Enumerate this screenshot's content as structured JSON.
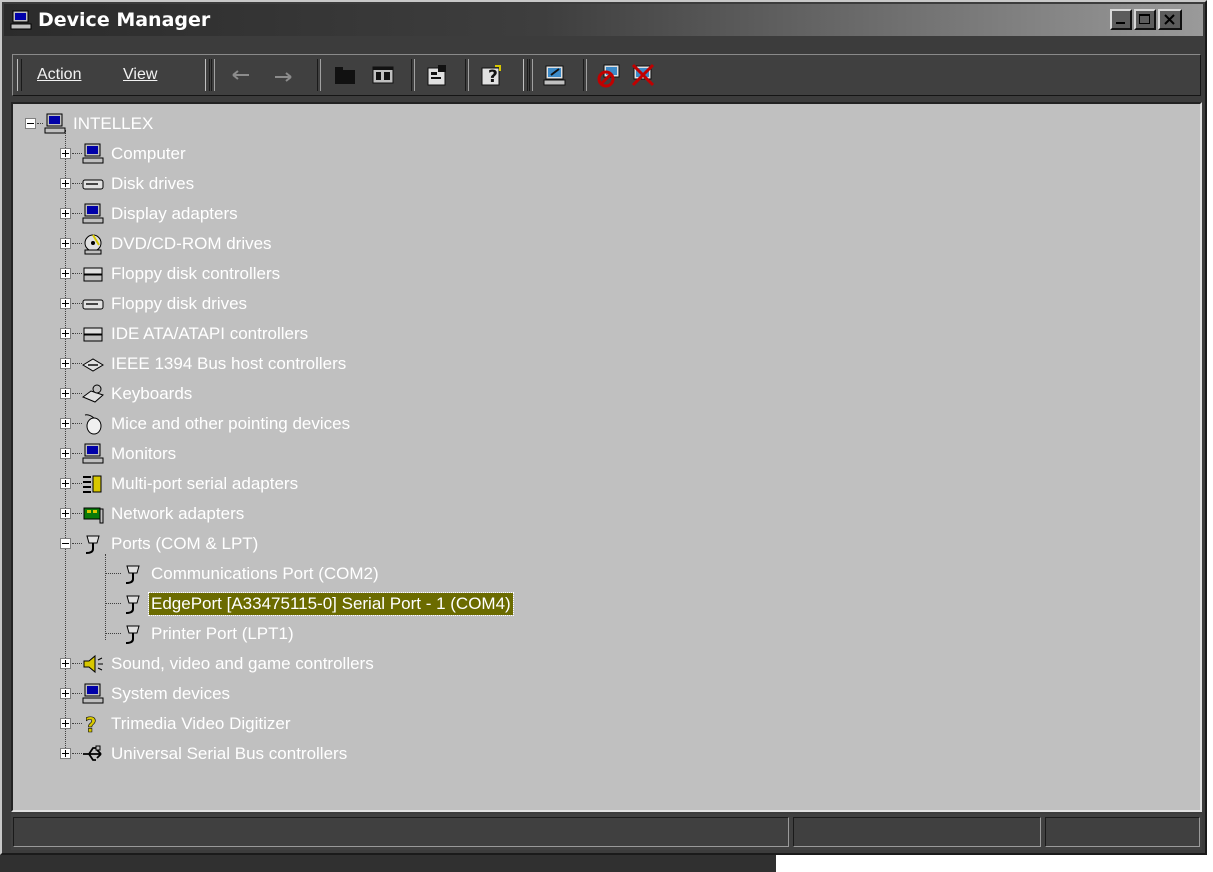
{
  "window": {
    "title": "Device Manager"
  },
  "title_buttons": {
    "minimize": "minimize-icon",
    "maximize": "maximize-icon",
    "close": "close-icon"
  },
  "menu": {
    "action": "Action",
    "view": "View"
  },
  "toolbar_icons": [
    "back-arrow-icon",
    "forward-arrow-icon",
    "up-folder-icon",
    "show-hide-tree-icon",
    "properties-icon",
    "help-icon",
    "scan-hardware-icon",
    "disable-device-icon",
    "uninstall-device-icon"
  ],
  "tree": {
    "root": "INTELLEX",
    "categories": [
      "Computer",
      "Disk drives",
      "Display adapters",
      "DVD/CD-ROM drives",
      "Floppy disk controllers",
      "Floppy disk drives",
      "IDE ATA/ATAPI controllers",
      "IEEE 1394 Bus host controllers",
      "Keyboards",
      "Mice and other pointing devices",
      "Monitors",
      "Multi-port serial adapters",
      "Network adapters",
      "Ports (COM & LPT)",
      "Sound, video and game controllers",
      "System devices",
      "Trimedia Video Digitizer",
      "Universal Serial Bus controllers"
    ],
    "ports_children": [
      "Communications Port (COM2)",
      "EdgePort [A33475115-0] Serial Port - 1 (COM4)",
      "Printer Port (LPT1)"
    ],
    "selected": "EdgePort [A33475115-0] Serial Port - 1 (COM4)"
  },
  "colors": {
    "selection": "#6b6b00",
    "tree_bg": "#c0c0c0",
    "chrome": "#3c3c3c"
  }
}
